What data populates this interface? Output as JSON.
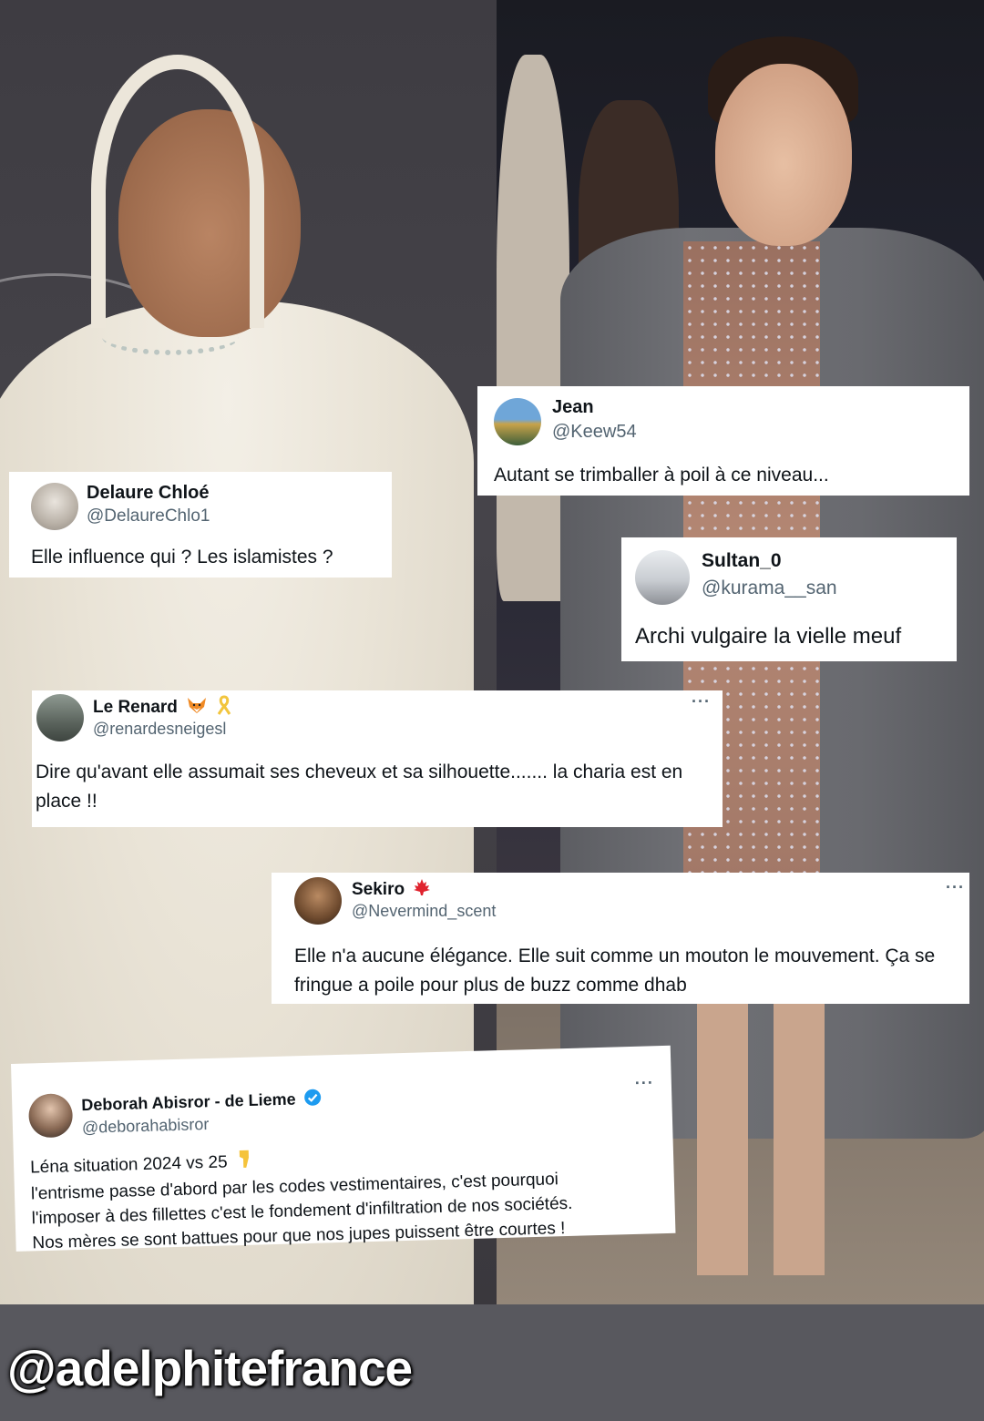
{
  "tweets": [
    {
      "name": "Jean",
      "handle": "@Keew54",
      "text": "Autant se trimballer à poil à ce niveau..."
    },
    {
      "name": "Delaure Chloé",
      "handle": "@DelaureChlo1",
      "text": "Elle influence qui ? Les islamistes ?"
    },
    {
      "name": "Sultan_0",
      "handle": "@kurama__san",
      "text": "Archi vulgaire la vielle meuf"
    },
    {
      "name": "Le Renard",
      "handle": "@renardesneigesl",
      "text": "Dire qu'avant elle assumait ses cheveux et sa silhouette....... la charia est en place !!",
      "more": "···"
    },
    {
      "name": "Sekiro",
      "handle": "@Nevermind_scent",
      "text": "Elle n'a aucune élégance. Elle suit comme un mouton le mouvement. Ça se fringue a poile pour plus de buzz comme dhab",
      "more": "···"
    },
    {
      "name": "Deborah Abisror - de Lieme",
      "handle": "@deborahabisror",
      "line1": "Léna situation 2024 vs 25",
      "line2": "l'entrisme passe d'abord par les codes vestimentaires, c'est pourquoi",
      "line3": "l'imposer à des fillettes c'est le fondement d'infiltration de nos sociétés.",
      "line4": "Nos mères se sont battues pour que nos jupes puissent être courtes !",
      "more": "···"
    }
  ],
  "footer": {
    "watermark": "@adelphitefrance"
  },
  "colors": {
    "text": "#0f1419",
    "secondary": "#536471",
    "verified": "#1d9bf0",
    "footer_bg": "#58585e"
  }
}
